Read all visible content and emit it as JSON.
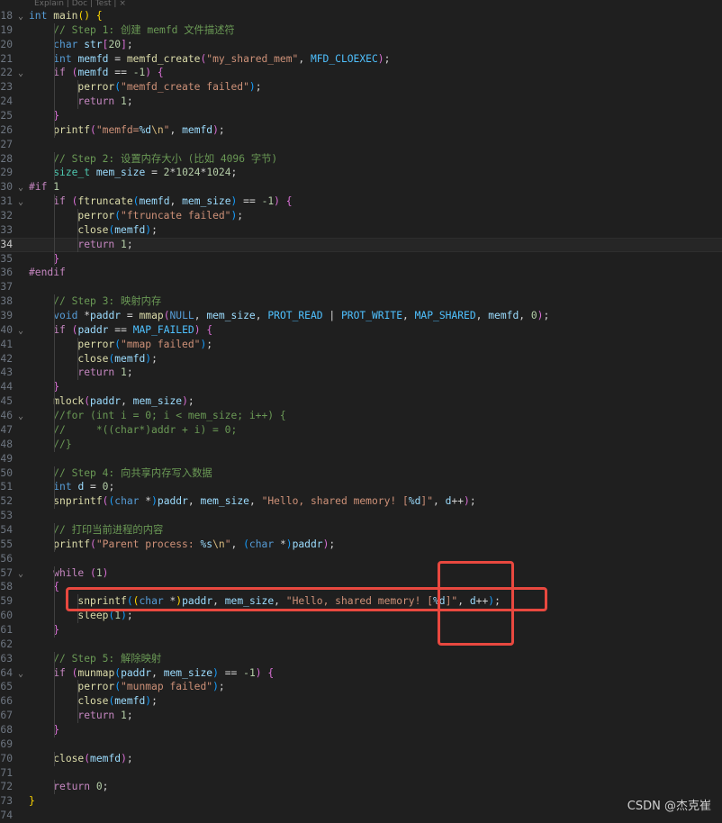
{
  "codelens_hint": "Explain | Doc | Test | ×",
  "current_line": 34,
  "highlight_boxes": [
    {
      "name": "snprintf-line-highlight"
    },
    {
      "name": "d-plusplus-vertical-highlight"
    }
  ],
  "lines": [
    {
      "n": "18",
      "fold": "v",
      "indent": 0,
      "tokens": [
        [
          "int",
          "kw"
        ],
        [
          " ",
          "op"
        ],
        [
          "main",
          "fn"
        ],
        [
          "()",
          "b1"
        ],
        [
          " ",
          "op"
        ],
        [
          "{",
          "b1"
        ]
      ]
    },
    {
      "n": "19",
      "fold": "",
      "indent": 1,
      "tokens": [
        [
          "// Step 1: 创建 memfd 文件描述符",
          "com"
        ]
      ]
    },
    {
      "n": "20",
      "fold": "",
      "indent": 1,
      "tokens": [
        [
          "char",
          "kw"
        ],
        [
          " ",
          "op"
        ],
        [
          "str",
          "var"
        ],
        [
          "[",
          "b2"
        ],
        [
          "20",
          "num"
        ],
        [
          "]",
          "b2"
        ],
        [
          ";",
          "op"
        ]
      ]
    },
    {
      "n": "21",
      "fold": "",
      "indent": 1,
      "tokens": [
        [
          "int",
          "kw"
        ],
        [
          " ",
          "op"
        ],
        [
          "memfd",
          "var"
        ],
        [
          " = ",
          "op"
        ],
        [
          "memfd_create",
          "fn"
        ],
        [
          "(",
          "b2"
        ],
        [
          "\"my_shared_mem\"",
          "str"
        ],
        [
          ", ",
          "op"
        ],
        [
          "MFD_CLOEXEC",
          "mac"
        ],
        [
          ")",
          "b2"
        ],
        [
          ";",
          "op"
        ]
      ]
    },
    {
      "n": "22",
      "fold": "v",
      "indent": 1,
      "tokens": [
        [
          "if",
          "ctrl"
        ],
        [
          " ",
          "op"
        ],
        [
          "(",
          "b2"
        ],
        [
          "memfd",
          "var"
        ],
        [
          " == ",
          "op"
        ],
        [
          "-1",
          "num"
        ],
        [
          ")",
          "b2"
        ],
        [
          " ",
          "op"
        ],
        [
          "{",
          "b2"
        ]
      ]
    },
    {
      "n": "23",
      "fold": "",
      "indent": 2,
      "tokens": [
        [
          "perror",
          "fn"
        ],
        [
          "(",
          "b3"
        ],
        [
          "\"memfd_create failed\"",
          "str"
        ],
        [
          ")",
          "b3"
        ],
        [
          ";",
          "op"
        ]
      ]
    },
    {
      "n": "24",
      "fold": "",
      "indent": 2,
      "tokens": [
        [
          "return",
          "ctrl"
        ],
        [
          " ",
          "op"
        ],
        [
          "1",
          "num"
        ],
        [
          ";",
          "op"
        ]
      ]
    },
    {
      "n": "25",
      "fold": "",
      "indent": 1,
      "tokens": [
        [
          "}",
          "b2"
        ]
      ]
    },
    {
      "n": "26",
      "fold": "",
      "indent": 1,
      "tokens": [
        [
          "printf",
          "fn"
        ],
        [
          "(",
          "b2"
        ],
        [
          "\"memfd=",
          "str"
        ],
        [
          "%d",
          "var"
        ],
        [
          "\\n",
          "esc"
        ],
        [
          "\"",
          "str"
        ],
        [
          ", ",
          "op"
        ],
        [
          "memfd",
          "var"
        ],
        [
          ")",
          "b2"
        ],
        [
          ";",
          "op"
        ]
      ]
    },
    {
      "n": "27",
      "fold": "",
      "indent": 0,
      "tokens": []
    },
    {
      "n": "28",
      "fold": "",
      "indent": 1,
      "tokens": [
        [
          "// Step 2: 设置内存大小 (比如 4096 字节)",
          "com"
        ]
      ]
    },
    {
      "n": "29",
      "fold": "",
      "indent": 1,
      "tokens": [
        [
          "size_t",
          "type"
        ],
        [
          " ",
          "op"
        ],
        [
          "mem_size",
          "var"
        ],
        [
          " = ",
          "op"
        ],
        [
          "2",
          "num"
        ],
        [
          "*",
          "op"
        ],
        [
          "1024",
          "num"
        ],
        [
          "*",
          "op"
        ],
        [
          "1024",
          "num"
        ],
        [
          ";",
          "op"
        ]
      ]
    },
    {
      "n": "30",
      "fold": "v",
      "indent": 0,
      "tokens": [
        [
          "#if",
          "pre"
        ],
        [
          " ",
          "op"
        ],
        [
          "1",
          "num"
        ]
      ]
    },
    {
      "n": "31",
      "fold": "v",
      "indent": 1,
      "tokens": [
        [
          "if",
          "ctrl"
        ],
        [
          " ",
          "op"
        ],
        [
          "(",
          "b2"
        ],
        [
          "ftruncate",
          "fn"
        ],
        [
          "(",
          "b3"
        ],
        [
          "memfd",
          "var"
        ],
        [
          ", ",
          "op"
        ],
        [
          "mem_size",
          "var"
        ],
        [
          ")",
          "b3"
        ],
        [
          " == ",
          "op"
        ],
        [
          "-1",
          "num"
        ],
        [
          ")",
          "b2"
        ],
        [
          " ",
          "op"
        ],
        [
          "{",
          "b2"
        ]
      ]
    },
    {
      "n": "32",
      "fold": "",
      "indent": 2,
      "tokens": [
        [
          "perror",
          "fn"
        ],
        [
          "(",
          "b3"
        ],
        [
          "\"ftruncate failed\"",
          "str"
        ],
        [
          ")",
          "b3"
        ],
        [
          ";",
          "op"
        ]
      ]
    },
    {
      "n": "33",
      "fold": "",
      "indent": 2,
      "tokens": [
        [
          "close",
          "fn"
        ],
        [
          "(",
          "b3"
        ],
        [
          "memfd",
          "var"
        ],
        [
          ")",
          "b3"
        ],
        [
          ";",
          "op"
        ]
      ]
    },
    {
      "n": "34",
      "fold": "",
      "indent": 2,
      "tokens": [
        [
          "return",
          "ctrl"
        ],
        [
          " ",
          "op"
        ],
        [
          "1",
          "num"
        ],
        [
          ";",
          "op"
        ]
      ]
    },
    {
      "n": "35",
      "fold": "",
      "indent": 1,
      "tokens": [
        [
          "}",
          "b2"
        ]
      ]
    },
    {
      "n": "36",
      "fold": "",
      "indent": 0,
      "tokens": [
        [
          "#endif",
          "pre"
        ]
      ]
    },
    {
      "n": "37",
      "fold": "",
      "indent": 0,
      "tokens": []
    },
    {
      "n": "38",
      "fold": "",
      "indent": 1,
      "tokens": [
        [
          "// Step 3: 映射内存",
          "com"
        ]
      ]
    },
    {
      "n": "39",
      "fold": "",
      "indent": 1,
      "tokens": [
        [
          "void",
          "kw"
        ],
        [
          " *",
          "op"
        ],
        [
          "paddr",
          "var"
        ],
        [
          " = ",
          "op"
        ],
        [
          "mmap",
          "fn"
        ],
        [
          "(",
          "b2"
        ],
        [
          "NULL",
          "kw"
        ],
        [
          ", ",
          "op"
        ],
        [
          "mem_size",
          "var"
        ],
        [
          ", ",
          "op"
        ],
        [
          "PROT_READ",
          "mac"
        ],
        [
          " | ",
          "op"
        ],
        [
          "PROT_WRITE",
          "mac"
        ],
        [
          ", ",
          "op"
        ],
        [
          "MAP_SHARED",
          "mac"
        ],
        [
          ", ",
          "op"
        ],
        [
          "memfd",
          "var"
        ],
        [
          ", ",
          "op"
        ],
        [
          "0",
          "num"
        ],
        [
          ")",
          "b2"
        ],
        [
          ";",
          "op"
        ]
      ]
    },
    {
      "n": "40",
      "fold": "v",
      "indent": 1,
      "tokens": [
        [
          "if",
          "ctrl"
        ],
        [
          " ",
          "op"
        ],
        [
          "(",
          "b2"
        ],
        [
          "paddr",
          "var"
        ],
        [
          " == ",
          "op"
        ],
        [
          "MAP_FAILED",
          "mac"
        ],
        [
          ")",
          "b2"
        ],
        [
          " ",
          "op"
        ],
        [
          "{",
          "b2"
        ]
      ]
    },
    {
      "n": "41",
      "fold": "",
      "indent": 2,
      "tokens": [
        [
          "perror",
          "fn"
        ],
        [
          "(",
          "b3"
        ],
        [
          "\"mmap failed\"",
          "str"
        ],
        [
          ")",
          "b3"
        ],
        [
          ";",
          "op"
        ]
      ]
    },
    {
      "n": "42",
      "fold": "",
      "indent": 2,
      "tokens": [
        [
          "close",
          "fn"
        ],
        [
          "(",
          "b3"
        ],
        [
          "memfd",
          "var"
        ],
        [
          ")",
          "b3"
        ],
        [
          ";",
          "op"
        ]
      ]
    },
    {
      "n": "43",
      "fold": "",
      "indent": 2,
      "tokens": [
        [
          "return",
          "ctrl"
        ],
        [
          " ",
          "op"
        ],
        [
          "1",
          "num"
        ],
        [
          ";",
          "op"
        ]
      ]
    },
    {
      "n": "44",
      "fold": "",
      "indent": 1,
      "tokens": [
        [
          "}",
          "b2"
        ]
      ]
    },
    {
      "n": "45",
      "fold": "",
      "indent": 1,
      "tokens": [
        [
          "mlock",
          "fn"
        ],
        [
          "(",
          "b2"
        ],
        [
          "paddr",
          "var"
        ],
        [
          ", ",
          "op"
        ],
        [
          "mem_size",
          "var"
        ],
        [
          ")",
          "b2"
        ],
        [
          ";",
          "op"
        ]
      ]
    },
    {
      "n": "46",
      "fold": "v",
      "indent": 1,
      "tokens": [
        [
          "//for (int i = 0; i < mem_size; i++) {",
          "com"
        ]
      ]
    },
    {
      "n": "47",
      "fold": "",
      "indent": 1,
      "tokens": [
        [
          "//     *((char*)addr + i) = 0;",
          "com"
        ]
      ]
    },
    {
      "n": "48",
      "fold": "",
      "indent": 1,
      "tokens": [
        [
          "//}",
          "com"
        ]
      ]
    },
    {
      "n": "49",
      "fold": "",
      "indent": 0,
      "tokens": []
    },
    {
      "n": "50",
      "fold": "",
      "indent": 1,
      "tokens": [
        [
          "// Step 4: 向共享内存写入数据",
          "com"
        ]
      ]
    },
    {
      "n": "51",
      "fold": "",
      "indent": 1,
      "tokens": [
        [
          "int",
          "kw"
        ],
        [
          " ",
          "op"
        ],
        [
          "d",
          "var"
        ],
        [
          " = ",
          "op"
        ],
        [
          "0",
          "num"
        ],
        [
          ";",
          "op"
        ]
      ]
    },
    {
      "n": "52",
      "fold": "",
      "indent": 1,
      "tokens": [
        [
          "snprintf",
          "fn"
        ],
        [
          "(",
          "b2"
        ],
        [
          "(",
          "b3"
        ],
        [
          "char",
          "kw"
        ],
        [
          " *",
          "op"
        ],
        [
          ")",
          "b3"
        ],
        [
          "paddr",
          "var"
        ],
        [
          ", ",
          "op"
        ],
        [
          "mem_size",
          "var"
        ],
        [
          ", ",
          "op"
        ],
        [
          "\"Hello, shared memory! [",
          "str"
        ],
        [
          "%d",
          "var"
        ],
        [
          "]\"",
          "str"
        ],
        [
          ", ",
          "op"
        ],
        [
          "d",
          "var"
        ],
        [
          "++",
          "op"
        ],
        [
          ")",
          "b2"
        ],
        [
          ";",
          "op"
        ]
      ]
    },
    {
      "n": "53",
      "fold": "",
      "indent": 0,
      "tokens": []
    },
    {
      "n": "54",
      "fold": "",
      "indent": 1,
      "tokens": [
        [
          "// 打印当前进程的内容",
          "com"
        ]
      ]
    },
    {
      "n": "55",
      "fold": "",
      "indent": 1,
      "tokens": [
        [
          "printf",
          "fn"
        ],
        [
          "(",
          "b2"
        ],
        [
          "\"Parent process: ",
          "str"
        ],
        [
          "%s",
          "var"
        ],
        [
          "\\n",
          "esc"
        ],
        [
          "\"",
          "str"
        ],
        [
          ", ",
          "op"
        ],
        [
          "(",
          "b3"
        ],
        [
          "char",
          "kw"
        ],
        [
          " *",
          "op"
        ],
        [
          ")",
          "b3"
        ],
        [
          "paddr",
          "var"
        ],
        [
          ")",
          "b2"
        ],
        [
          ";",
          "op"
        ]
      ]
    },
    {
      "n": "56",
      "fold": "",
      "indent": 0,
      "tokens": []
    },
    {
      "n": "57",
      "fold": "v",
      "indent": 1,
      "tokens": [
        [
          "while",
          "ctrl"
        ],
        [
          " ",
          "op"
        ],
        [
          "(",
          "b2"
        ],
        [
          "1",
          "num"
        ],
        [
          ")",
          "b2"
        ]
      ]
    },
    {
      "n": "58",
      "fold": "",
      "indent": 1,
      "tokens": [
        [
          "{",
          "b2"
        ]
      ]
    },
    {
      "n": "59",
      "fold": "",
      "indent": 2,
      "tokens": [
        [
          "snprintf",
          "fn"
        ],
        [
          "(",
          "b3"
        ],
        [
          "(",
          "b1"
        ],
        [
          "char",
          "kw"
        ],
        [
          " *",
          "op"
        ],
        [
          ")",
          "b1"
        ],
        [
          "paddr",
          "var"
        ],
        [
          ", ",
          "op"
        ],
        [
          "mem_size",
          "var"
        ],
        [
          ", ",
          "op"
        ],
        [
          "\"Hello, shared memory! [",
          "str"
        ],
        [
          "%d",
          "var"
        ],
        [
          "]\"",
          "str"
        ],
        [
          ", ",
          "op"
        ],
        [
          "d",
          "var"
        ],
        [
          "++",
          "op"
        ],
        [
          ")",
          "b3"
        ],
        [
          ";",
          "op"
        ]
      ]
    },
    {
      "n": "60",
      "fold": "",
      "indent": 2,
      "tokens": [
        [
          "sleep",
          "fn"
        ],
        [
          "(",
          "b3"
        ],
        [
          "1",
          "num"
        ],
        [
          ")",
          "b3"
        ],
        [
          ";",
          "op"
        ]
      ]
    },
    {
      "n": "61",
      "fold": "",
      "indent": 1,
      "tokens": [
        [
          "}",
          "b2"
        ]
      ]
    },
    {
      "n": "62",
      "fold": "",
      "indent": 0,
      "tokens": []
    },
    {
      "n": "63",
      "fold": "",
      "indent": 1,
      "tokens": [
        [
          "// Step 5: 解除映射",
          "com"
        ]
      ]
    },
    {
      "n": "64",
      "fold": "v",
      "indent": 1,
      "tokens": [
        [
          "if",
          "ctrl"
        ],
        [
          " ",
          "op"
        ],
        [
          "(",
          "b2"
        ],
        [
          "munmap",
          "fn"
        ],
        [
          "(",
          "b3"
        ],
        [
          "paddr",
          "var"
        ],
        [
          ", ",
          "op"
        ],
        [
          "mem_size",
          "var"
        ],
        [
          ")",
          "b3"
        ],
        [
          " == ",
          "op"
        ],
        [
          "-1",
          "num"
        ],
        [
          ")",
          "b2"
        ],
        [
          " ",
          "op"
        ],
        [
          "{",
          "b2"
        ]
      ]
    },
    {
      "n": "65",
      "fold": "",
      "indent": 2,
      "tokens": [
        [
          "perror",
          "fn"
        ],
        [
          "(",
          "b3"
        ],
        [
          "\"munmap failed\"",
          "str"
        ],
        [
          ")",
          "b3"
        ],
        [
          ";",
          "op"
        ]
      ]
    },
    {
      "n": "66",
      "fold": "",
      "indent": 2,
      "tokens": [
        [
          "close",
          "fn"
        ],
        [
          "(",
          "b3"
        ],
        [
          "memfd",
          "var"
        ],
        [
          ")",
          "b3"
        ],
        [
          ";",
          "op"
        ]
      ]
    },
    {
      "n": "67",
      "fold": "",
      "indent": 2,
      "tokens": [
        [
          "return",
          "ctrl"
        ],
        [
          " ",
          "op"
        ],
        [
          "1",
          "num"
        ],
        [
          ";",
          "op"
        ]
      ]
    },
    {
      "n": "68",
      "fold": "",
      "indent": 1,
      "tokens": [
        [
          "}",
          "b2"
        ]
      ]
    },
    {
      "n": "69",
      "fold": "",
      "indent": 0,
      "tokens": []
    },
    {
      "n": "70",
      "fold": "",
      "indent": 1,
      "tokens": [
        [
          "close",
          "fn"
        ],
        [
          "(",
          "b2"
        ],
        [
          "memfd",
          "var"
        ],
        [
          ")",
          "b2"
        ],
        [
          ";",
          "op"
        ]
      ]
    },
    {
      "n": "71",
      "fold": "",
      "indent": 0,
      "tokens": []
    },
    {
      "n": "72",
      "fold": "",
      "indent": 1,
      "tokens": [
        [
          "return",
          "ctrl"
        ],
        [
          " ",
          "op"
        ],
        [
          "0",
          "num"
        ],
        [
          ";",
          "op"
        ]
      ]
    },
    {
      "n": "73",
      "fold": "",
      "indent": 0,
      "tokens": [
        [
          "}",
          "b1"
        ]
      ]
    },
    {
      "n": "74",
      "fold": "",
      "indent": 0,
      "tokens": []
    }
  ],
  "watermark": "CSDN @杰克崔",
  "colors": {
    "background": "#1f1f1f",
    "annotation_red": "#e8483f"
  }
}
